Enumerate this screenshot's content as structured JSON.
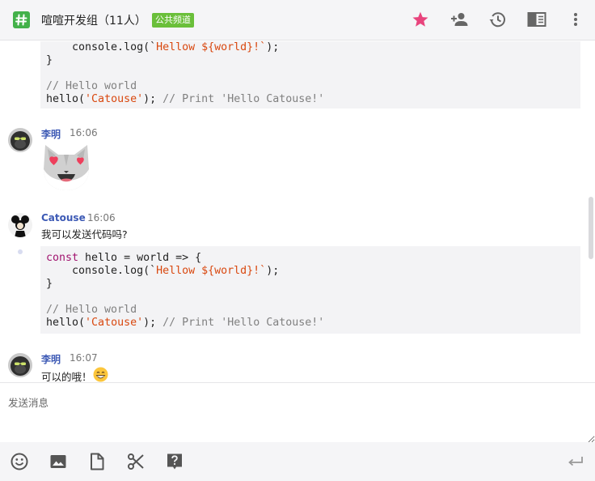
{
  "header": {
    "channel_name": "喧喧开发组（11人）",
    "channel_badge": "公共频道",
    "icons": [
      "hash-icon",
      "star-icon",
      "add-member-icon",
      "history-icon",
      "sidebar-toggle-icon",
      "more-icon"
    ],
    "colors": {
      "accent_green": "#43b14a",
      "badge_green": "#6abf3a",
      "star_pink": "#e8447d"
    }
  },
  "messages": {
    "code_block_top": {
      "lines": [
        {
          "parts": [
            {
              "t": "    console.log(`",
              "c": ""
            },
            {
              "t": "Hellow ${world}!`",
              "c": "str"
            },
            {
              "t": ");",
              "c": ""
            }
          ]
        },
        {
          "parts": [
            {
              "t": "}",
              "c": ""
            }
          ]
        },
        {
          "parts": [
            {
              "t": "",
              "c": ""
            }
          ]
        },
        {
          "parts": [
            {
              "t": "// Hello world",
              "c": "cm"
            }
          ]
        },
        {
          "parts": [
            {
              "t": "hello(",
              "c": ""
            },
            {
              "t": "'Catouse'",
              "c": "str"
            },
            {
              "t": "); ",
              "c": ""
            },
            {
              "t": "// Print 'Hello Catouse!'",
              "c": "cm"
            }
          ]
        }
      ]
    },
    "msg1": {
      "author": "李明",
      "time": "16:06",
      "content_icon": "heart-eyes-cat-emoji"
    },
    "msg2": {
      "author": "Catouse",
      "time": "16:06",
      "text": "我可以发送代码吗?"
    },
    "code_block_2": {
      "lines": [
        {
          "parts": [
            {
              "t": "const",
              "c": "kw"
            },
            {
              "t": " hello = world => {",
              "c": ""
            }
          ]
        },
        {
          "parts": [
            {
              "t": "    console.log(`",
              "c": ""
            },
            {
              "t": "Hellow ${world}!`",
              "c": "str"
            },
            {
              "t": ");",
              "c": ""
            }
          ]
        },
        {
          "parts": [
            {
              "t": "}",
              "c": ""
            }
          ]
        },
        {
          "parts": [
            {
              "t": "",
              "c": ""
            }
          ]
        },
        {
          "parts": [
            {
              "t": "// Hello world",
              "c": "cm"
            }
          ]
        },
        {
          "parts": [
            {
              "t": "hello(",
              "c": ""
            },
            {
              "t": "'Catouse'",
              "c": "str"
            },
            {
              "t": "); ",
              "c": ""
            },
            {
              "t": "// Print 'Hello Catouse!'",
              "c": "cm"
            }
          ]
        }
      ]
    },
    "msg3": {
      "author": "李明",
      "time": "16:07",
      "text": "可以的哦！",
      "emoji": "grinning-face-emoji"
    }
  },
  "composer": {
    "placeholder": "发送消息",
    "value": ""
  },
  "toolbar": {
    "icons": [
      "emoji-icon",
      "image-icon",
      "file-icon",
      "screenshot-icon",
      "help-icon",
      "send-icon"
    ]
  }
}
